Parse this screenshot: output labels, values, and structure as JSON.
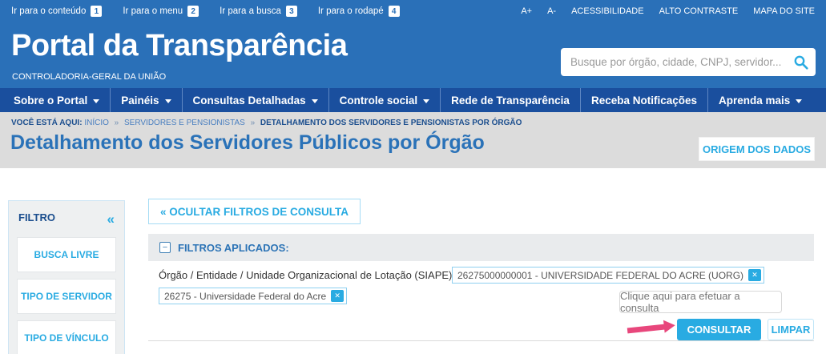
{
  "topbar": {
    "skip_links": [
      {
        "label": "Ir para o conteúdo",
        "key": "1"
      },
      {
        "label": "Ir para o menu",
        "key": "2"
      },
      {
        "label": "Ir para a busca",
        "key": "3"
      },
      {
        "label": "Ir para o rodapé",
        "key": "4"
      }
    ],
    "actions": [
      "A+",
      "A-",
      "ACESSIBILIDADE",
      "ALTO CONTRASTE",
      "MAPA DO SITE"
    ]
  },
  "header": {
    "title": "Portal da Transparência",
    "subtitle": "CONTROLADORIA-GERAL DA UNIÃO",
    "search_placeholder": "Busque por órgão, cidade, CNPJ, servidor..."
  },
  "nav": {
    "items": [
      {
        "label": "Sobre o Portal",
        "dropdown": true
      },
      {
        "label": "Painéis",
        "dropdown": true
      },
      {
        "label": "Consultas Detalhadas",
        "dropdown": true
      },
      {
        "label": "Controle social",
        "dropdown": true
      },
      {
        "label": "Rede de Transparência",
        "dropdown": false
      },
      {
        "label": "Receba Notificações",
        "dropdown": false
      },
      {
        "label": "Aprenda mais",
        "dropdown": true
      }
    ]
  },
  "breadcrumb": {
    "prefix": "VOCÊ ESTÁ AQUI:",
    "separator": "»",
    "items": [
      "INÍCIO",
      "SERVIDORES E PENSIONISTAS",
      "DETALHAMENTO DOS SERVIDORES E PENSIONISTAS POR ÓRGÃO"
    ]
  },
  "page": {
    "title": "Detalhamento dos Servidores Públicos por Órgão",
    "origin_button": "ORIGEM DOS DADOS"
  },
  "sidebar": {
    "title": "FILTRO",
    "collapse_icon": "«",
    "items": [
      {
        "label": "BUSCA LIVRE"
      },
      {
        "label": "TIPO DE SERVIDOR"
      },
      {
        "label": "TIPO DE VÍNCULO"
      }
    ]
  },
  "filters": {
    "hide_button": "« OCULTAR FILTROS DE CONSULTA",
    "applied_title": "FILTROS APLICADOS:",
    "field_label": "Órgão / Entidade / Unidade Organizacional de Lotação (SIAPE):",
    "tags": [
      {
        "label": "26275000000001 - UNIVERSIDADE FEDERAL DO ACRE (UORG)"
      },
      {
        "label": "26275 - Universidade Federal do Acre"
      }
    ],
    "tooltip": "Clique aqui para efetuar a consulta",
    "consult_button": "CONSULTAR",
    "clear_button": "LIMPAR"
  },
  "icons": {
    "minus": "−",
    "close": "✕"
  },
  "colors": {
    "header_blue": "#2a70b8",
    "nav_blue": "#1a4f9e",
    "accent_blue": "#29abe2",
    "navy_text": "#1b4e8e",
    "title_blue": "#2a72b8",
    "band_gray": "#dcdcdc",
    "panel_head_gray": "#e9ebed",
    "arrow_pink": "#e8477c"
  }
}
